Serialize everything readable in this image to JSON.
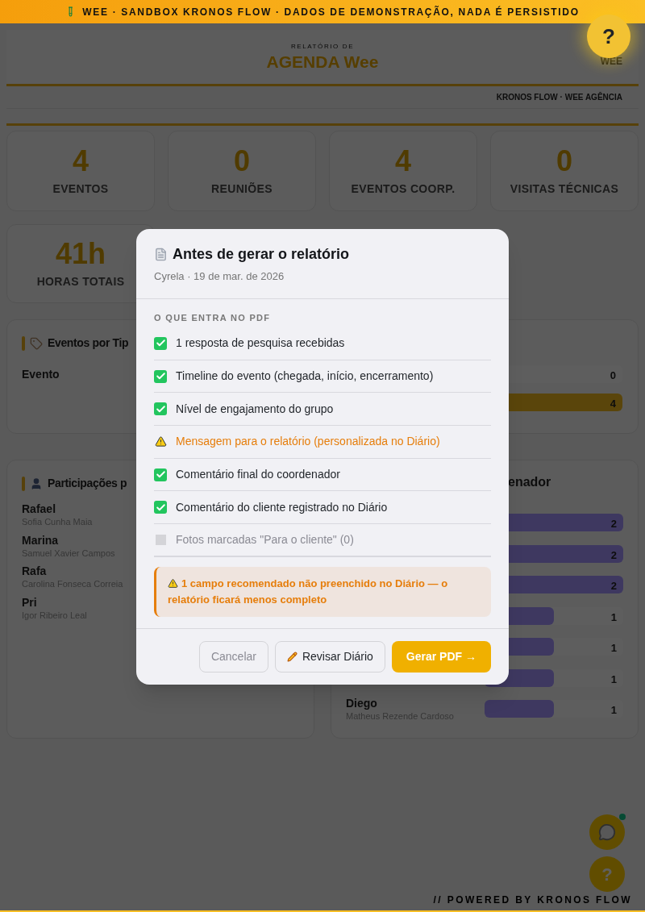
{
  "banner": {
    "text": "WEE · SANDBOX KRONOS FLOW · DADOS DE DEMONSTRAÇÃO, NADA É PERSISTIDO"
  },
  "help_button": {
    "label": "?"
  },
  "header": {
    "eyebrow": "RELATÓRIO DE",
    "title": "AGENDA Wee",
    "brand": "WEE",
    "subtitle": "KRONOS FLOW · WEE AGÊNCIA"
  },
  "stats": [
    {
      "value": "4",
      "label": "EVENTOS"
    },
    {
      "value": "0",
      "label": "REUNIÕES"
    },
    {
      "value": "4",
      "label": "EVENTOS COORP."
    },
    {
      "value": "0",
      "label": "VISITAS TÉCNICAS"
    },
    {
      "value": "41h",
      "label": "HORAS TOTAIS"
    }
  ],
  "events_panel": {
    "title": "Eventos por Tip",
    "rows": [
      {
        "name": "Evento",
        "value": "0",
        "level": 0
      },
      {
        "value": "4",
        "level": 1
      }
    ]
  },
  "participants_panel": {
    "title": "Participações p",
    "people": [
      {
        "name": "Rafael",
        "detail": "Sofia Cunha Maia"
      },
      {
        "name": "Marina",
        "detail": "Samuel Xavier Campos"
      },
      {
        "name": "Rafa",
        "detail": "Carolina Fonseca Correia"
      },
      {
        "name": "Pri",
        "detail": "Igor Ribeiro Leal"
      }
    ]
  },
  "coordinator_panel": {
    "title": "enador",
    "rows": [
      {
        "value": "2",
        "level": 1
      },
      {
        "value": "2",
        "level": 1
      },
      {
        "value": "2",
        "level": 1
      },
      {
        "value": "1",
        "level": 0.5
      },
      {
        "value": "1",
        "level": 0.5
      },
      {
        "value": "1",
        "level": 0.5
      },
      {
        "name": "Diego",
        "detail": "Matheus Rezende Cardoso",
        "value": "1",
        "level": 0.5
      }
    ]
  },
  "chat_button": {
    "online": true
  },
  "help_fab": {
    "label": "?"
  },
  "footer": {
    "text": "// POWERED BY KRONOS FLOW"
  },
  "modal": {
    "title": "Antes de gerar o relatório",
    "subtitle": "Cyrela · 19 de mar. de 2026",
    "section": "O QUE ENTRA NO PDF",
    "items": [
      {
        "label": "1 resposta de pesquisa recebidas",
        "kind": "ok"
      },
      {
        "label": "Timeline do evento (chegada, início, encerramento)",
        "kind": "ok"
      },
      {
        "label": "Nível de engajamento do grupo",
        "kind": "ok"
      },
      {
        "label": "Mensagem para o relatório (personalizada no Diário)",
        "kind": "warn"
      },
      {
        "label": "Comentário final do coordenador",
        "kind": "ok"
      },
      {
        "label": "Comentário do cliente registrado no Diário",
        "kind": "ok"
      },
      {
        "label": "Fotos marcadas \"Para o cliente\" (0)",
        "kind": "empty"
      }
    ],
    "warning": "1 campo recomendado não preenchido no Diário — o relatório ficará menos completo",
    "buttons": [
      {
        "label": "Cancelar",
        "kind": "cancel"
      },
      {
        "label": "Revisar Diário",
        "kind": "edit"
      },
      {
        "label": "Gerar PDF →",
        "kind": "primary"
      }
    ]
  }
}
